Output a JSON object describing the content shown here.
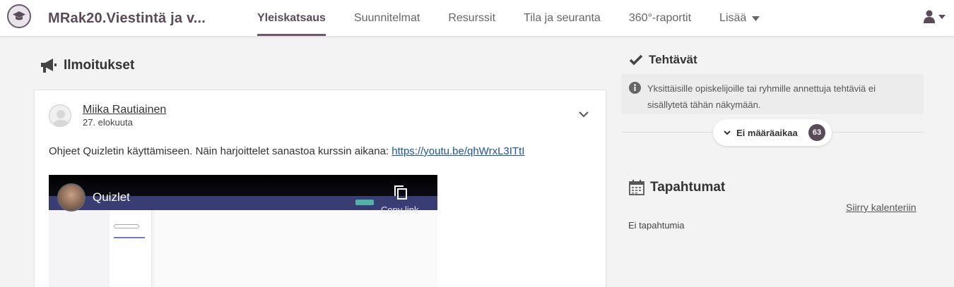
{
  "header": {
    "course_title": "MRak20.Viestintä ja v...",
    "nav": [
      {
        "label": "Yleiskatsaus",
        "active": true
      },
      {
        "label": "Suunnitelmat",
        "active": false
      },
      {
        "label": "Resurssit",
        "active": false
      },
      {
        "label": "Tila ja seuranta",
        "active": false
      },
      {
        "label": "360°-raportit",
        "active": false
      }
    ],
    "more_label": "Lisää",
    "logo_icon": "graduation-cap-icon",
    "user_icon": "user-icon"
  },
  "announcements": {
    "title": "Ilmoitukset",
    "icon": "megaphone-icon",
    "post": {
      "author": "Miika Rautiainen",
      "date": "27. elokuuta",
      "text": "Ohjeet Quizletin käyttämiseen. Näin harjoittelet sanastoa kurssin aikana: ",
      "link_text": "https://youtu.be/qhWrxL3ITtI",
      "video": {
        "title": "Quizlet",
        "copy_label": "Copy link"
      }
    }
  },
  "tasks": {
    "title": "Tehtävät",
    "icon": "check-icon",
    "info": "Yksittäisille opiskelijoille tai ryhmille annettuja tehtäviä ei sisällytetä tähän näkymään.",
    "filter_label": "Ei määräaikaa",
    "count": "63"
  },
  "events": {
    "title": "Tapahtumat",
    "icon": "calendar-icon",
    "calendar_link": "Siirry kalenteriin",
    "empty_text": "Ei tapahtumia"
  },
  "colors": {
    "brand": "#5a4a5a",
    "link": "#1a55a6",
    "background": "#f3f3f3"
  }
}
